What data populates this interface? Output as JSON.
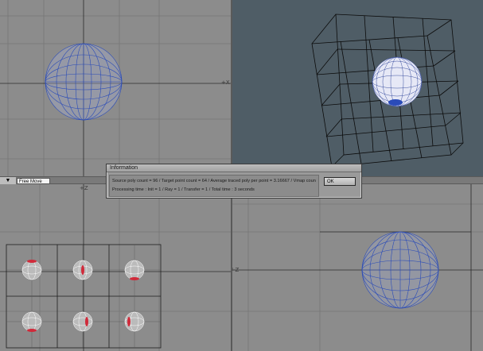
{
  "dialog": {
    "title": "Information",
    "line1": "Source poly count = 96 / Target point count = 64 / Average traced poly per point = 3.16667 / Vmap count =1",
    "line2": "Processing time : Init = 1 / Ray = 1 / Transfer = 1 / Total time : 3 seconds",
    "ok_label": "OK"
  },
  "toolbar": {
    "arrow_glyph": "▼",
    "mode_value": "Free Move"
  },
  "viewports": {
    "top_left_axis": "+X",
    "bottom_left_axis": "+Z",
    "bottom_right_axis": "+U-Z"
  },
  "colors": {
    "wire_blue": "#2a4bb8",
    "wire_white": "#e8e8ff",
    "grid_dark": "#222222",
    "viewport_gray": "#8c8c8c",
    "perspective_bg": "#4f5d66",
    "highlight_red": "#d02a3a"
  }
}
